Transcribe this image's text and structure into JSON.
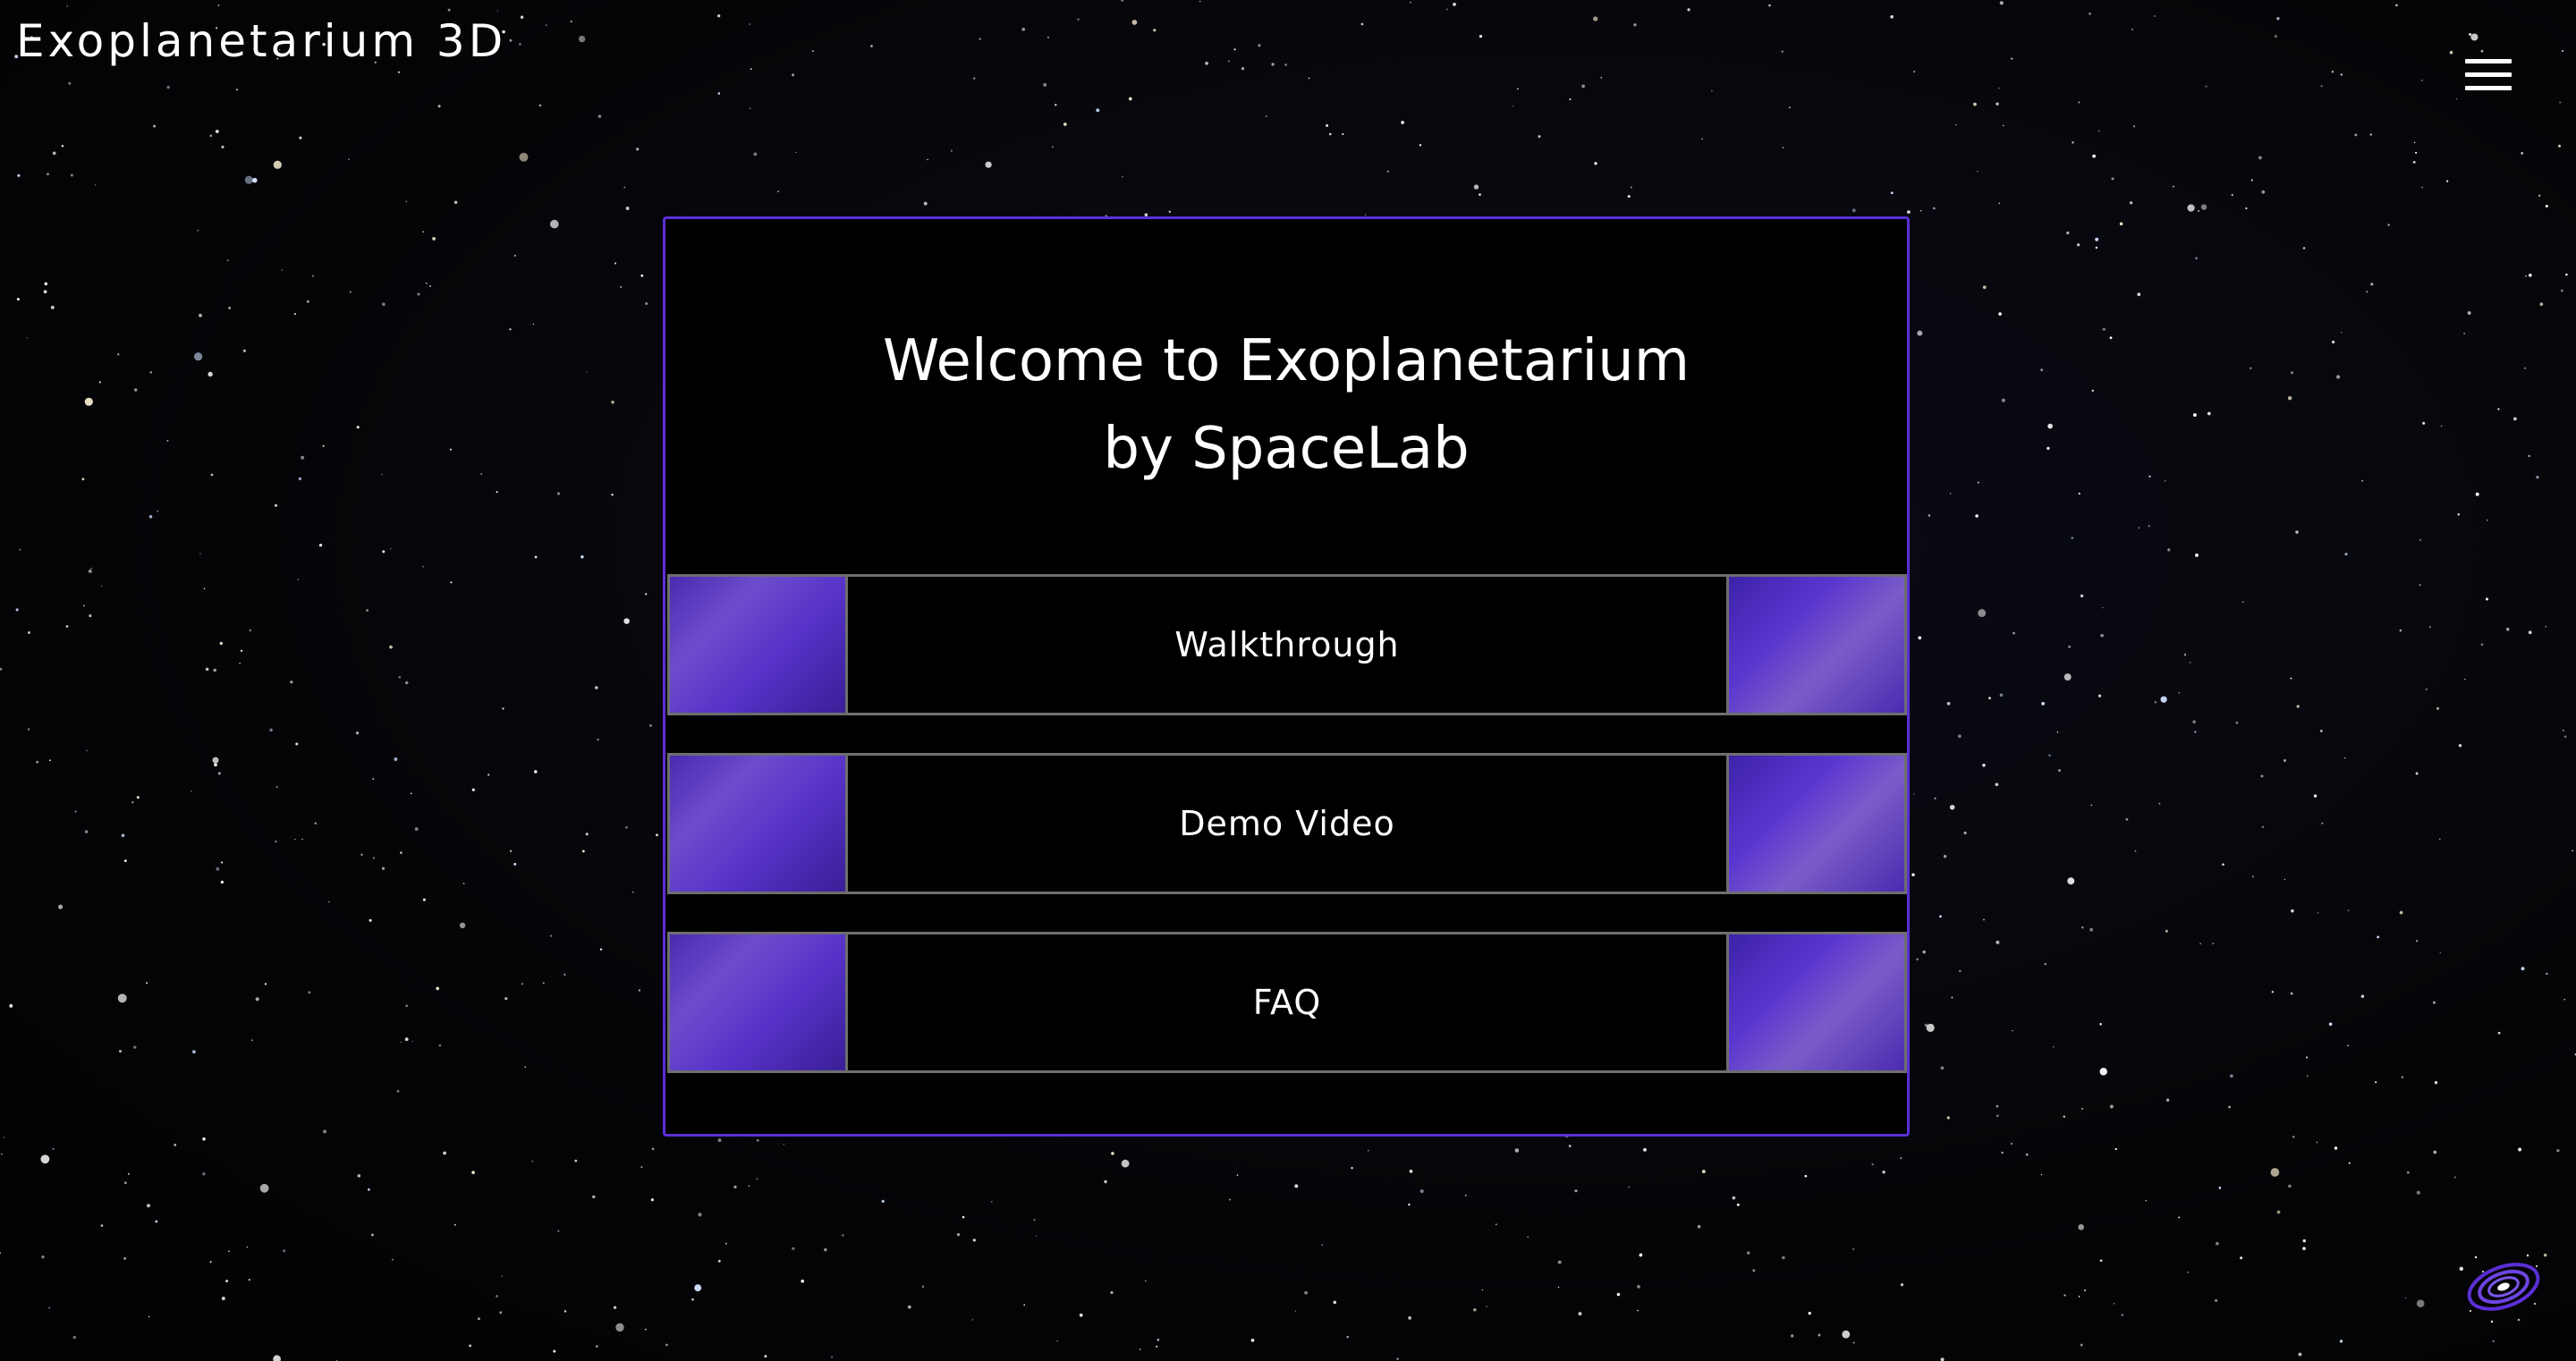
{
  "header": {
    "app_title": "Exoplanetarium 3D",
    "menu_icon": "hamburger-menu-icon"
  },
  "panel": {
    "welcome_line1": "Welcome to Exoplanetarium",
    "welcome_line2": "by SpaceLab",
    "nav_items": [
      {
        "label": "Walkthrough"
      },
      {
        "label": "Demo Video"
      },
      {
        "label": "FAQ"
      }
    ]
  },
  "footer": {
    "galaxy_icon": "galaxy-icon"
  },
  "colors": {
    "accent": "#5b2fd6",
    "tile": "#5632c8",
    "row_border": "#6e6e6e",
    "background": "#000000",
    "text": "#ffffff"
  }
}
